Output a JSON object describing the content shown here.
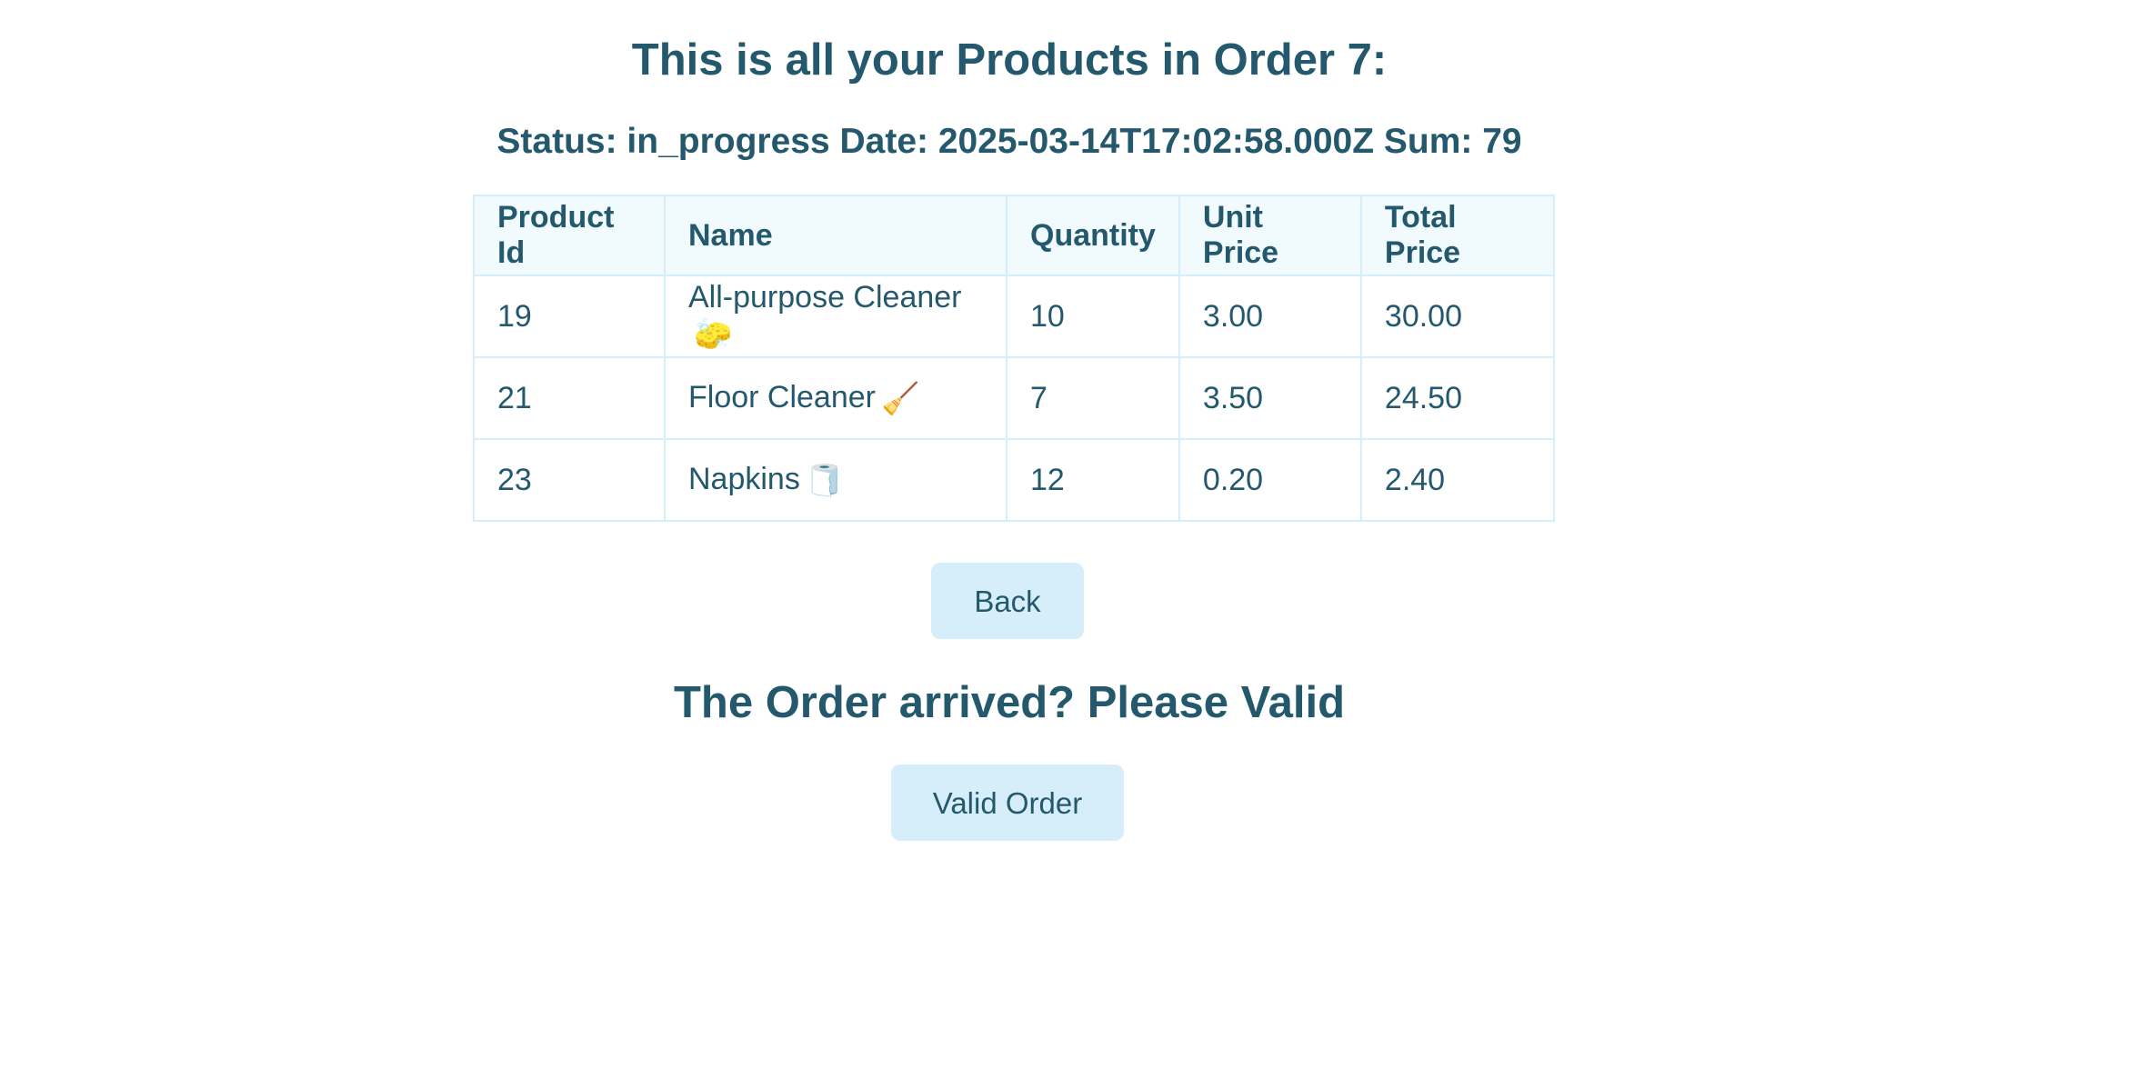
{
  "header": {
    "title": "This is all your Products in Order 7:",
    "status_line": "Status: in_progress Date: 2025-03-14T17:02:58.000Z Sum: 79"
  },
  "table": {
    "columns": [
      "Product Id",
      "Name",
      "Quantity",
      "Unit Price",
      "Total Price"
    ],
    "rows": [
      {
        "product_id": "19",
        "name": "All-purpose Cleaner",
        "emoji": "🧽",
        "quantity": "10",
        "unit_price": "3.00",
        "total_price": "30.00"
      },
      {
        "product_id": "21",
        "name": "Floor Cleaner",
        "emoji": "🧹",
        "quantity": "7",
        "unit_price": "3.50",
        "total_price": "24.50"
      },
      {
        "product_id": "23",
        "name": "Napkins",
        "emoji": "🧻",
        "quantity": "12",
        "unit_price": "0.20",
        "total_price": "2.40"
      }
    ]
  },
  "actions": {
    "back_label": "Back",
    "question": "The Order arrived? Please Valid",
    "valid_label": "Valid Order"
  },
  "colors": {
    "text": "#24596d",
    "button_bg": "#d6eef9",
    "header_bg": "#f1fbfe",
    "border": "#d6eef9"
  }
}
